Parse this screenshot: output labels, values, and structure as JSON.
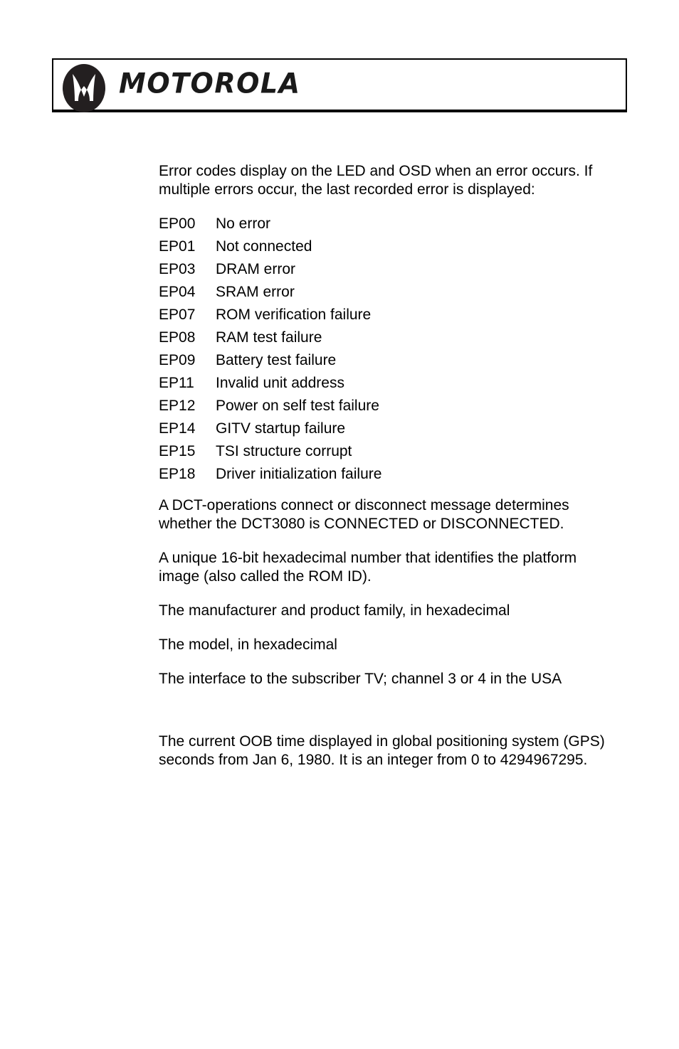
{
  "header": {
    "logo_icon": "motorola-batwing-logo",
    "wordmark": "MOTOROLA"
  },
  "body": {
    "intro": "Error codes display on the LED and OSD when an error occurs. If multiple errors occur, the last recorded error is displayed:",
    "error_codes": [
      {
        "code": "EP00",
        "description": "No error"
      },
      {
        "code": "EP01",
        "description": "Not connected"
      },
      {
        "code": "EP03",
        "description": "DRAM error"
      },
      {
        "code": "EP04",
        "description": "SRAM error"
      },
      {
        "code": "EP07",
        "description": "ROM verification failure"
      },
      {
        "code": "EP08",
        "description": "RAM test failure"
      },
      {
        "code": "EP09",
        "description": "Battery test failure"
      },
      {
        "code": "EP11",
        "description": "Invalid unit address"
      },
      {
        "code": "EP12",
        "description": "Power on self test failure"
      },
      {
        "code": "EP14",
        "description": "GITV startup failure"
      },
      {
        "code": "EP15",
        "description": "TSI structure corrupt"
      },
      {
        "code": "EP18",
        "description": "Driver initialization failure"
      }
    ],
    "paragraphs": [
      "A DCT-operations connect or disconnect message determines whether the DCT3080 is CONNECTED or DISCONNECTED.",
      "A unique 16-bit hexadecimal number that identifies the platform image (also called the ROM ID).",
      "The manufacturer and product family, in hexadecimal",
      "The model, in hexadecimal",
      "The interface to the subscriber TV; channel 3 or 4 in the USA"
    ],
    "closing_paragraph": "The current OOB time displayed in global positioning system (GPS) seconds from Jan 6, 1980. It is an integer from 0 to 4294967295."
  }
}
